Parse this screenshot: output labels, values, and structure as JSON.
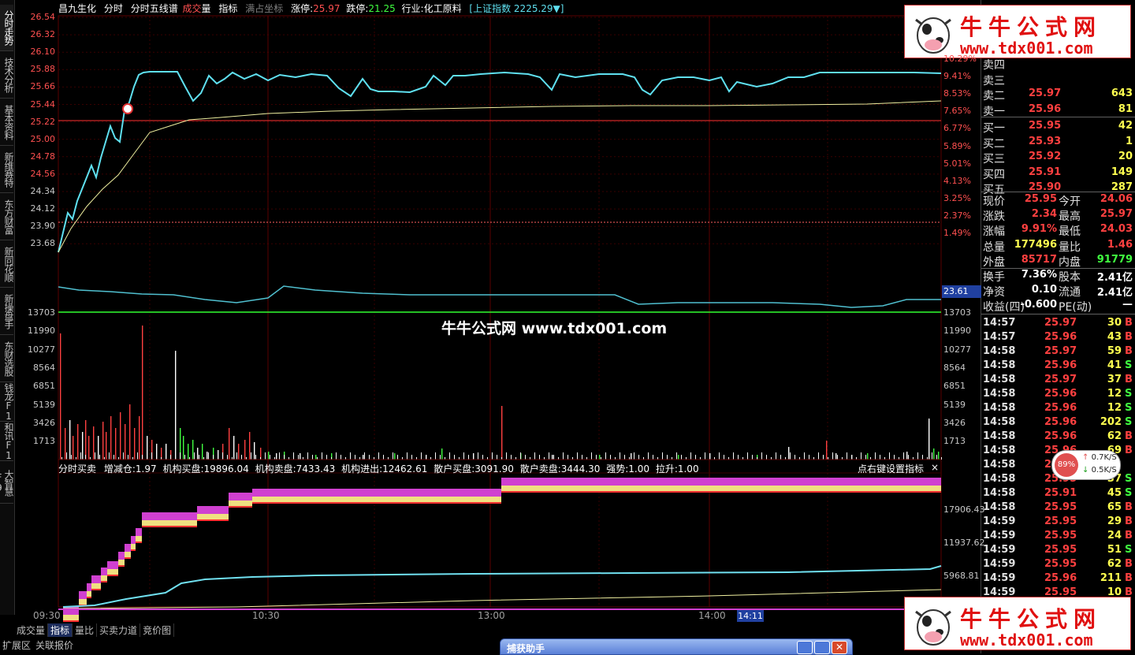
{
  "header": {
    "stock_name": "昌九生化",
    "items": [
      "分时",
      "分时五线谱"
    ],
    "vol_label_a": "成交",
    "vol_label_b": "量",
    "indicator": "指标",
    "full_axis": "满占坐标",
    "limit_up_label": "涨停:",
    "limit_up": "25.97",
    "limit_down_label": "跌停:",
    "limit_down": "21.25",
    "industry": "行业:化工原料",
    "index": "[上证指数 2225.29▼]"
  },
  "left_tabs": [
    "分时走势",
    "技术分析",
    "基本资料",
    "新维赛特",
    "东方财富",
    "新同花顺",
    "新操盘手",
    "东财选股",
    "钱龙F1",
    "和讯F1",
    "大智慧F9"
  ],
  "price_axis_left": [
    "26.54",
    "26.32",
    "26.10",
    "25.88",
    "25.66",
    "25.44",
    "25.22",
    "25.00",
    "24.78",
    "24.56",
    "24.34",
    "24.12",
    "23.90",
    "23.68"
  ],
  "pct_axis_right": [
    "10.29%",
    "9.41%",
    "8.53%",
    "7.65%",
    "6.77%",
    "5.89%",
    "5.01%",
    "4.13%",
    "3.25%",
    "2.37%",
    "1.49%"
  ],
  "avg_tag": "23.61",
  "vol_axis": [
    "13703",
    "11990",
    "10277",
    "8564",
    "6851",
    "5139",
    "3426",
    "1713"
  ],
  "center_watermark": "牛牛公式网 www.tdx001.com",
  "indicator_line": {
    "name": "分时买卖",
    "parts": [
      "增减仓:1.97",
      "机构买盘:19896.04",
      "机构卖盘:7433.43",
      "机构进出:12462.61",
      "散户买盘:3091.90",
      "散户卖盘:3444.30",
      "强势:1.00",
      "拉升:1.00"
    ],
    "hint": "点右键设置指标",
    "close": "×"
  },
  "ind_axis": [
    "17906.43",
    "11937.62",
    "5968.81"
  ],
  "time_axis": [
    "09:30",
    "10:30",
    "13:00",
    "14:00"
  ],
  "time_cursor": "14:11",
  "bottom_tabs": [
    "成交量",
    "指标",
    "量比",
    "买卖力道",
    "竞价图"
  ],
  "bottom_tabs2": [
    "扩展区",
    "关联报价"
  ],
  "popup_title": "捕获助手",
  "watermark": {
    "title": "牛牛公式网",
    "url": "www.tdx001.com"
  },
  "orderbook": [
    {
      "label": "卖四",
      "price": "",
      "vol": ""
    },
    {
      "label": "卖三",
      "price": "",
      "vol": ""
    },
    {
      "label": "卖二",
      "price": "25.97",
      "vol": "643"
    },
    {
      "label": "卖一",
      "price": "25.96",
      "vol": "81"
    },
    {
      "label": "买一",
      "price": "25.95",
      "vol": "42"
    },
    {
      "label": "买二",
      "price": "25.93",
      "vol": "1"
    },
    {
      "label": "买三",
      "price": "25.92",
      "vol": "20"
    },
    {
      "label": "买四",
      "price": "25.91",
      "vol": "149"
    },
    {
      "label": "买五",
      "price": "25.90",
      "vol": "287"
    }
  ],
  "quote": [
    {
      "l1": "现价",
      "v1": "25.95",
      "l2": "今开",
      "v2": "24.06"
    },
    {
      "l1": "涨跌",
      "v1": "2.34",
      "l2": "最高",
      "v2": "25.97"
    },
    {
      "l1": "涨幅",
      "v1": "9.91%",
      "l2": "最低",
      "v2": "24.03"
    },
    {
      "l1": "总量",
      "v1": "177496",
      "l2": "量比",
      "v2": "1.46"
    },
    {
      "l1": "外盘",
      "v1": "85717",
      "l2": "内盘",
      "v2": "91779"
    },
    {
      "l1": "换手",
      "v1": "7.36%",
      "l2": "股本",
      "v2": "2.41亿"
    },
    {
      "l1": "净资",
      "v1": "0.10",
      "l2": "流通",
      "v2": "2.41亿"
    },
    {
      "l1": "收益(四)",
      "v1": "-0.600",
      "l2": "PE(动)",
      "v2": "—"
    }
  ],
  "ticks": [
    {
      "t": "14:57",
      "p": "25.97",
      "v": "30",
      "s": "B"
    },
    {
      "t": "14:57",
      "p": "25.96",
      "v": "43",
      "s": "B"
    },
    {
      "t": "14:58",
      "p": "25.97",
      "v": "59",
      "s": "B"
    },
    {
      "t": "14:58",
      "p": "25.96",
      "v": "41",
      "s": "S"
    },
    {
      "t": "14:58",
      "p": "25.97",
      "v": "37",
      "s": "B"
    },
    {
      "t": "14:58",
      "p": "25.96",
      "v": "12",
      "s": "S"
    },
    {
      "t": "14:58",
      "p": "25.96",
      "v": "12",
      "s": "S"
    },
    {
      "t": "14:58",
      "p": "25.96",
      "v": "202",
      "s": "S"
    },
    {
      "t": "14:58",
      "p": "25.96",
      "v": "62",
      "B": "",
      "s": "B"
    },
    {
      "t": "14:58",
      "p": "25.96",
      "v": "69",
      "s": "B"
    },
    {
      "t": "14:58",
      "p": "25.96",
      "v": "",
      "s": ""
    },
    {
      "t": "14:58",
      "p": "25.95",
      "v": "37",
      "s": "S"
    },
    {
      "t": "14:58",
      "p": "25.91",
      "v": "45",
      "s": "S"
    },
    {
      "t": "14:58",
      "p": "25.95",
      "v": "65",
      "s": "B"
    },
    {
      "t": "14:59",
      "p": "25.95",
      "v": "29",
      "s": "B"
    },
    {
      "t": "14:59",
      "p": "25.95",
      "v": "24",
      "s": "B"
    },
    {
      "t": "14:59",
      "p": "25.95",
      "v": "51",
      "s": "S"
    },
    {
      "t": "14:59",
      "p": "25.95",
      "v": "62",
      "s": "B"
    },
    {
      "t": "14:59",
      "p": "25.96",
      "v": "211",
      "s": "B"
    },
    {
      "t": "14:59",
      "p": "25.95",
      "v": "10",
      "s": "B"
    }
  ],
  "speed": {
    "pct": "89%",
    "up": "0.7K/S",
    "down": "0.5K/S"
  },
  "colors": {
    "price_line": "#5fe0f0",
    "avg_line": "#f0f0a0",
    "up": "#ff4040",
    "down": "#40ff40",
    "grid": "#3a0000"
  }
}
